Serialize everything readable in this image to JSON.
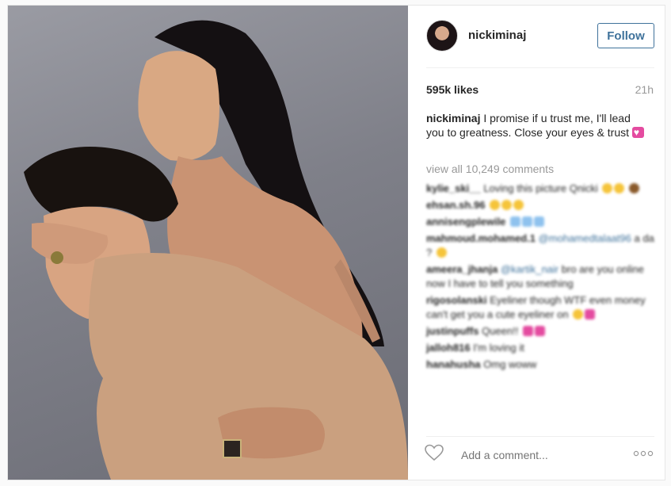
{
  "header": {
    "username": "nickiminaj",
    "follow_label": "Follow"
  },
  "post": {
    "likes": "595k likes",
    "time": "21h",
    "caption_user": "nickiminaj",
    "caption_text": "I promise if u trust me, I'll lead you to greatness. Close your eyes & trust",
    "view_all": "view all 10,249 comments"
  },
  "comments": [
    {
      "user": "kylie_ski__",
      "text": "Loving this picture Qnicki",
      "mention": ""
    },
    {
      "user": "ehsan.sh.96",
      "text": "",
      "mention": ""
    },
    {
      "user": "annisengplewile",
      "text": "",
      "mention": ""
    },
    {
      "user": "mahmoud.mohamed.1",
      "text": "a da ?",
      "mention": "@mohamedtalaat96"
    },
    {
      "user": "ameera_jhanja",
      "text": "bro are you online now I have to tell you something",
      "mention": "@kartik_nair"
    },
    {
      "user": "rigosolanski",
      "text": "Eyeliner though WTF even money can't get you a cute eyeliner on",
      "mention": ""
    },
    {
      "user": "justinpuffs",
      "text": "Queen!!",
      "mention": ""
    },
    {
      "user": "jalloh816",
      "text": "I'm loving it",
      "mention": ""
    },
    {
      "user": "hanahusha",
      "text": "Omg woww",
      "mention": ""
    }
  ],
  "footer": {
    "comment_placeholder": "Add a comment...",
    "like_icon": "heart-outline-icon",
    "more_icon": "more-options-icon"
  },
  "colors": {
    "link_blue": "#3f729b",
    "text_dark": "#262626",
    "text_muted": "#999999"
  }
}
